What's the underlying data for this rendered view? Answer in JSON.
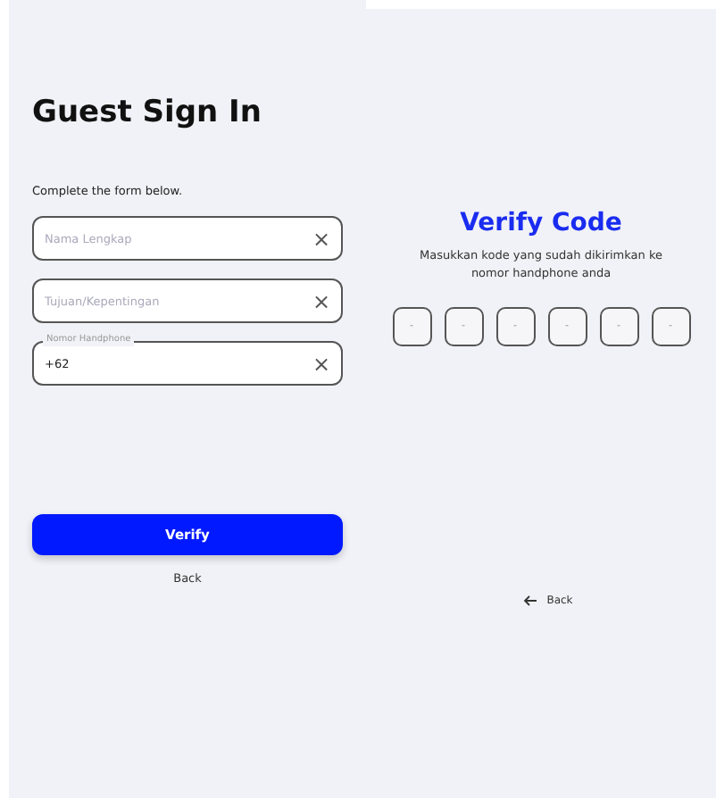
{
  "sign_in": {
    "title": "Guest Sign In",
    "subtitle": "Complete the form below.",
    "fields": [
      {
        "placeholder": "Nama Lengkap",
        "clear": "×"
      },
      {
        "placeholder": "Tujuan/Kepentingan",
        "clear": "×"
      },
      {
        "label": "Nomor Handphone",
        "value": "+62",
        "clear": "×"
      }
    ],
    "submit": "Verify",
    "back": "Back"
  },
  "verify": {
    "title": "Verify Code",
    "description": "Masukkan kode yang sudah dikirimkan ke nomor handphone anda",
    "code_inputs": [
      {
        "placeholder": "-"
      },
      {
        "placeholder": "-"
      },
      {
        "placeholder": "-"
      },
      {
        "placeholder": "-"
      },
      {
        "placeholder": "-"
      },
      {
        "placeholder": "-"
      }
    ],
    "back": "Back"
  }
}
